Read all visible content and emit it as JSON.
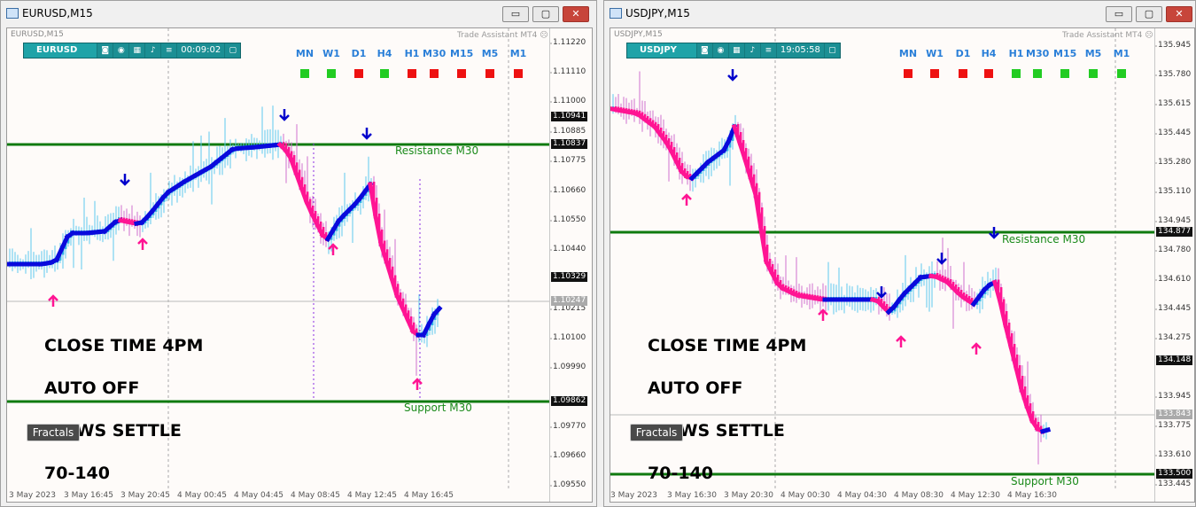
{
  "windows": [
    {
      "id": "eurusd",
      "title": "EURUSD,M15",
      "header_label": "EURUSD,M15",
      "symbol": "EURUSD",
      "timer": "00:09:02",
      "assistant": "Trade Assistant MT4",
      "timeframes": [
        {
          "label": "MN",
          "color": "#22cc22"
        },
        {
          "label": "W1",
          "color": "#22cc22"
        },
        {
          "label": "D1",
          "color": "#ee1111"
        },
        {
          "label": "H4",
          "color": "#22cc22"
        },
        {
          "label": "H1",
          "color": "#ee1111"
        },
        {
          "label": "M30",
          "color": "#ee1111"
        },
        {
          "label": "M15",
          "color": "#ee1111"
        },
        {
          "label": "M5",
          "color": "#ee1111"
        },
        {
          "label": "M1",
          "color": "#ee1111"
        }
      ],
      "price_labels": [
        "1.11220",
        "1.11110",
        "1.11000",
        "1.10885",
        "1.10775",
        "1.10660",
        "1.10550",
        "1.10440",
        "1.10215",
        "1.10100",
        "1.09990",
        "1.09770",
        "1.09660",
        "1.09550"
      ],
      "price_boxes": [
        {
          "value": "1.10941",
          "style": "dark"
        },
        {
          "value": "1.10837",
          "style": "dark"
        },
        {
          "value": "1.10329",
          "style": "dark"
        },
        {
          "value": "1.10247",
          "style": "grey"
        },
        {
          "value": "1.09862",
          "style": "dark"
        }
      ],
      "time_labels": [
        "3 May 2023",
        "3 May 16:45",
        "3 May 20:45",
        "4 May 00:45",
        "4 May 04:45",
        "4 May 08:45",
        "4 May 12:45",
        "4 May 16:45"
      ],
      "resistance": "Resistance M30",
      "support": "Support M30",
      "note_lines": [
        "CLOSE TIME 4PM",
        "AUTO OFF",
        " NEWS SETTLE",
        "70-140"
      ],
      "fractals": "Fractals"
    },
    {
      "id": "usdjpy",
      "title": "USDJPY,M15",
      "header_label": "USDJPY,M15",
      "symbol": "USDJPY",
      "timer": "19:05:58",
      "assistant": "Trade Assistant MT4",
      "timeframes": [
        {
          "label": "MN",
          "color": "#ee1111"
        },
        {
          "label": "W1",
          "color": "#ee1111"
        },
        {
          "label": "D1",
          "color": "#ee1111"
        },
        {
          "label": "H4",
          "color": "#ee1111"
        },
        {
          "label": "H1",
          "color": "#22cc22"
        },
        {
          "label": "M30",
          "color": "#22cc22"
        },
        {
          "label": "M15",
          "color": "#22cc22"
        },
        {
          "label": "M5",
          "color": "#22cc22"
        },
        {
          "label": "M1",
          "color": "#22cc22"
        }
      ],
      "price_labels": [
        "135.945",
        "135.780",
        "135.615",
        "135.445",
        "135.280",
        "135.110",
        "134.945",
        "134.780",
        "134.610",
        "134.445",
        "134.275",
        "133.945",
        "133.775",
        "133.610",
        "133.445"
      ],
      "price_boxes": [
        {
          "value": "134.877",
          "style": "dark"
        },
        {
          "value": "134.148",
          "style": "dark"
        },
        {
          "value": "133.843",
          "style": "grey"
        },
        {
          "value": "133.500",
          "style": "dark"
        }
      ],
      "time_labels": [
        "3 May 2023",
        "3 May 16:30",
        "3 May 20:30",
        "4 May 00:30",
        "4 May 04:30",
        "4 May 08:30",
        "4 May 12:30",
        "4 May 16:30"
      ],
      "resistance": "Resistance M30",
      "support": "Support M30",
      "note_lines": [
        "CLOSE TIME 4PM",
        "AUTO OFF",
        " NEWS SETTLE",
        "70-140"
      ],
      "fractals": "Fractals"
    }
  ],
  "window_buttons": {
    "minimize": "▭",
    "maximize": "▢",
    "close": "✕"
  },
  "colors": {
    "up_candle": "#33b5e5",
    "down_candle": "#ff1493",
    "trend_up": "#0a0adc",
    "trend_down": "#ff1493",
    "level_line": "#0f7a0f",
    "arrow_up": "#ff1493",
    "arrow_down": "#0000cc"
  }
}
